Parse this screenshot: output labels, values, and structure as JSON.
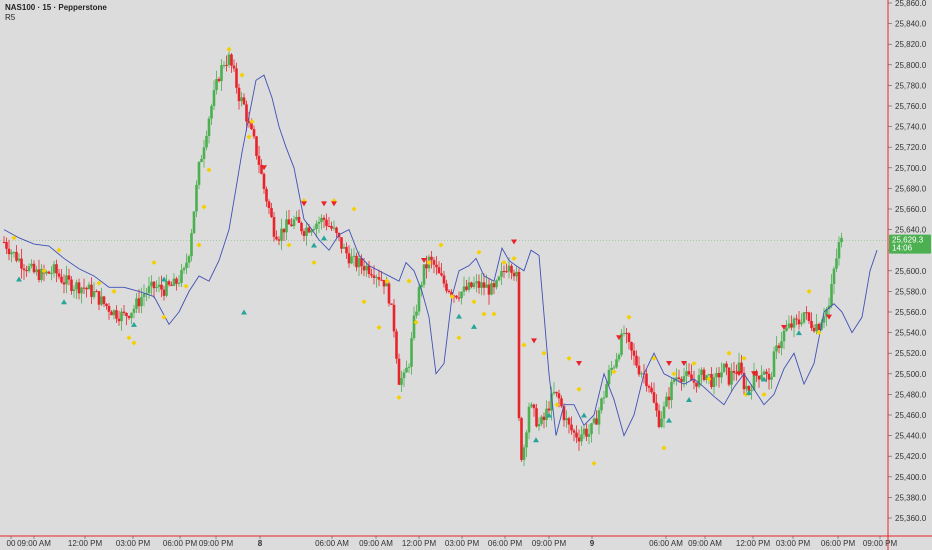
{
  "chart_data": {
    "type": "candlestick",
    "title": "NAS100 · 15 · Pepperstone",
    "indicator_label": "R5",
    "ylim": [
      25350,
      25870
    ],
    "y_ticks": [
      "25,360.0",
      "25,380.0",
      "25,400.0",
      "25,420.0",
      "25,440.0",
      "25,460.0",
      "25,480.0",
      "25,500.0",
      "25,520.0",
      "25,540.0",
      "25,560.0",
      "25,580.0",
      "25,600.0",
      "25,620.0",
      "25,640.0",
      "25,660.0",
      "25,680.0",
      "25,700.0",
      "25,720.0",
      "25,740.0",
      "25,760.0",
      "25,780.0",
      "25,800.0",
      "25,820.0",
      "25,840.0",
      "25,860.0"
    ],
    "x_ticks": [
      "00",
      "09:00 AM",
      "12:00 PM",
      "03:00 PM",
      "06:00 PM",
      "09:00 PM",
      "8",
      "06:00 AM",
      "09:00 AM",
      "12:00 PM",
      "03:00 PM",
      "06:00 PM",
      "09:00 PM",
      "9",
      "06:00 AM",
      "09:00 AM",
      "12:00 PM",
      "03:00 PM",
      "06:00 PM",
      "09:00 PM"
    ],
    "current_price": {
      "value": 25629.3,
      "label": "25,629.3",
      "countdown": "14:06"
    },
    "colors": {
      "up": "#4caf50",
      "down": "#e8232b",
      "line": "#3f51b5",
      "marker_yellow": "#f5d000",
      "marker_up": "#26a69a",
      "marker_down": "#e8232b",
      "price_tag": "#4caf50",
      "grid_ref": "#8bc98b",
      "axis_border": "#e8232b"
    },
    "close_anchors": [
      [
        0,
        25628
      ],
      [
        10,
        25616
      ],
      [
        20,
        25606
      ],
      [
        30,
        25598
      ],
      [
        40,
        25596
      ],
      [
        50,
        25600
      ],
      [
        60,
        25590
      ],
      [
        70,
        25586
      ],
      [
        80,
        25584
      ],
      [
        90,
        25578
      ],
      [
        100,
        25568
      ],
      [
        110,
        25560
      ],
      [
        120,
        25556
      ],
      [
        130,
        25564
      ],
      [
        140,
        25578
      ],
      [
        150,
        25584
      ],
      [
        160,
        25582
      ],
      [
        170,
        25586
      ],
      [
        180,
        25598
      ],
      [
        185,
        25620
      ],
      [
        190,
        25660
      ],
      [
        195,
        25700
      ],
      [
        200,
        25725
      ],
      [
        205,
        25750
      ],
      [
        210,
        25770
      ],
      [
        215,
        25790
      ],
      [
        220,
        25803
      ],
      [
        225,
        25806
      ],
      [
        230,
        25790
      ],
      [
        235,
        25770
      ],
      [
        240,
        25760
      ],
      [
        245,
        25740
      ],
      [
        250,
        25725
      ],
      [
        255,
        25705
      ],
      [
        260,
        25680
      ],
      [
        265,
        25660
      ],
      [
        270,
        25640
      ],
      [
        275,
        25635
      ],
      [
        280,
        25642
      ],
      [
        285,
        25644
      ],
      [
        290,
        25648
      ],
      [
        300,
        25640
      ],
      [
        310,
        25646
      ],
      [
        320,
        25650
      ],
      [
        330,
        25638
      ],
      [
        340,
        25620
      ],
      [
        350,
        25608
      ],
      [
        360,
        25605
      ],
      [
        370,
        25600
      ],
      [
        380,
        25590
      ],
      [
        385,
        25575
      ],
      [
        390,
        25545
      ],
      [
        395,
        25495
      ],
      [
        400,
        25495
      ],
      [
        405,
        25512
      ],
      [
        410,
        25550
      ],
      [
        415,
        25580
      ],
      [
        420,
        25600
      ],
      [
        425,
        25610
      ],
      [
        430,
        25605
      ],
      [
        435,
        25595
      ],
      [
        440,
        25588
      ],
      [
        450,
        25578
      ],
      [
        460,
        25580
      ],
      [
        470,
        25586
      ],
      [
        480,
        25585
      ],
      [
        490,
        25580
      ],
      [
        500,
        25600
      ],
      [
        505,
        25610
      ],
      [
        510,
        25600
      ],
      [
        513,
        25592
      ],
      [
        514,
        25470
      ],
      [
        517,
        25420
      ],
      [
        520,
        25430
      ],
      [
        525,
        25470
      ],
      [
        530,
        25460
      ],
      [
        535,
        25450
      ],
      [
        540,
        25455
      ],
      [
        545,
        25470
      ],
      [
        550,
        25480
      ],
      [
        555,
        25475
      ],
      [
        560,
        25460
      ],
      [
        565,
        25448
      ],
      [
        570,
        25442
      ],
      [
        575,
        25440
      ],
      [
        580,
        25445
      ],
      [
        585,
        25442
      ],
      [
        590,
        25450
      ],
      [
        595,
        25465
      ],
      [
        600,
        25480
      ],
      [
        605,
        25500
      ],
      [
        610,
        25510
      ],
      [
        615,
        25525
      ],
      [
        620,
        25540
      ],
      [
        625,
        25525
      ],
      [
        630,
        25515
      ],
      [
        635,
        25505
      ],
      [
        640,
        25500
      ],
      [
        645,
        25490
      ],
      [
        650,
        25470
      ],
      [
        655,
        25455
      ],
      [
        660,
        25465
      ],
      [
        665,
        25480
      ],
      [
        670,
        25495
      ],
      [
        675,
        25500
      ],
      [
        680,
        25498
      ],
      [
        685,
        25495
      ],
      [
        690,
        25492
      ],
      [
        695,
        25495
      ],
      [
        700,
        25500
      ],
      [
        705,
        25497
      ],
      [
        710,
        25490
      ],
      [
        715,
        25500
      ],
      [
        720,
        25505
      ],
      [
        725,
        25495
      ],
      [
        730,
        25503
      ],
      [
        735,
        25505
      ],
      [
        740,
        25490
      ],
      [
        745,
        25485
      ],
      [
        750,
        25497
      ],
      [
        755,
        25500
      ],
      [
        760,
        25505
      ],
      [
        765,
        25490
      ],
      [
        770,
        25515
      ],
      [
        775,
        25530
      ],
      [
        780,
        25540
      ],
      [
        785,
        25545
      ],
      [
        790,
        25548
      ],
      [
        795,
        25550
      ],
      [
        800,
        25560
      ],
      [
        805,
        25550
      ],
      [
        810,
        25548
      ],
      [
        815,
        25548
      ],
      [
        820,
        25560
      ],
      [
        825,
        25565
      ],
      [
        830,
        25600
      ],
      [
        835,
        25625
      ],
      [
        838,
        25629
      ]
    ],
    "line_anchors": [
      [
        0,
        25640
      ],
      [
        15,
        25632
      ],
      [
        30,
        25626
      ],
      [
        45,
        25624
      ],
      [
        60,
        25612
      ],
      [
        75,
        25602
      ],
      [
        90,
        25595
      ],
      [
        105,
        25584
      ],
      [
        120,
        25584
      ],
      [
        135,
        25580
      ],
      [
        150,
        25575
      ],
      [
        165,
        25548
      ],
      [
        175,
        25560
      ],
      [
        185,
        25580
      ],
      [
        195,
        25595
      ],
      [
        205,
        25590
      ],
      [
        215,
        25610
      ],
      [
        225,
        25640
      ],
      [
        232,
        25680
      ],
      [
        238,
        25715
      ],
      [
        245,
        25750
      ],
      [
        252,
        25785
      ],
      [
        260,
        25790
      ],
      [
        268,
        25768
      ],
      [
        275,
        25740
      ],
      [
        282,
        25720
      ],
      [
        290,
        25700
      ],
      [
        300,
        25650
      ],
      [
        308,
        25640
      ],
      [
        315,
        25630
      ],
      [
        325,
        25620
      ],
      [
        335,
        25635
      ],
      [
        345,
        25640
      ],
      [
        355,
        25615
      ],
      [
        365,
        25605
      ],
      [
        375,
        25600
      ],
      [
        385,
        25595
      ],
      [
        395,
        25590
      ],
      [
        402,
        25608
      ],
      [
        410,
        25600
      ],
      [
        418,
        25580
      ],
      [
        425,
        25555
      ],
      [
        432,
        25500
      ],
      [
        440,
        25510
      ],
      [
        448,
        25575
      ],
      [
        455,
        25600
      ],
      [
        465,
        25605
      ],
      [
        472,
        25612
      ],
      [
        480,
        25595
      ],
      [
        490,
        25590
      ],
      [
        498,
        25622
      ],
      [
        505,
        25610
      ],
      [
        512,
        25605
      ],
      [
        520,
        25600
      ],
      [
        527,
        25620
      ],
      [
        535,
        25615
      ],
      [
        545,
        25500
      ],
      [
        552,
        25440
      ],
      [
        560,
        25470
      ],
      [
        570,
        25470
      ],
      [
        580,
        25450
      ],
      [
        590,
        25460
      ],
      [
        600,
        25500
      ],
      [
        610,
        25475
      ],
      [
        620,
        25440
      ],
      [
        630,
        25460
      ],
      [
        640,
        25500
      ],
      [
        650,
        25520
      ],
      [
        660,
        25500
      ],
      [
        670,
        25495
      ],
      [
        680,
        25490
      ],
      [
        690,
        25495
      ],
      [
        700,
        25487
      ],
      [
        710,
        25478
      ],
      [
        720,
        25470
      ],
      [
        730,
        25487
      ],
      [
        740,
        25500
      ],
      [
        750,
        25485
      ],
      [
        760,
        25470
      ],
      [
        770,
        25480
      ],
      [
        780,
        25505
      ],
      [
        790,
        25520
      ],
      [
        800,
        25490
      ],
      [
        810,
        25510
      ],
      [
        820,
        25560
      ],
      [
        830,
        25568
      ],
      [
        838,
        25560
      ],
      [
        848,
        25540
      ],
      [
        858,
        25555
      ],
      [
        866,
        25600
      ],
      [
        873,
        25620
      ]
    ]
  },
  "markers": {
    "yellow": [
      [
        10,
        25632
      ],
      [
        40,
        25600
      ],
      [
        55,
        25620
      ],
      [
        95,
        25588
      ],
      [
        110,
        25580
      ],
      [
        125,
        25535
      ],
      [
        130,
        25530
      ],
      [
        150,
        25608
      ],
      [
        160,
        25555
      ],
      [
        182,
        25585
      ],
      [
        195,
        25625
      ],
      [
        200,
        25662
      ],
      [
        205,
        25698
      ],
      [
        225,
        25815
      ],
      [
        238,
        25790
      ],
      [
        245,
        25730
      ],
      [
        248,
        25745
      ],
      [
        285,
        25625
      ],
      [
        300,
        25668
      ],
      [
        310,
        25608
      ],
      [
        330,
        25668
      ],
      [
        350,
        25660
      ],
      [
        360,
        25570
      ],
      [
        375,
        25545
      ],
      [
        383,
        25590
      ],
      [
        395,
        25477
      ],
      [
        405,
        25590
      ],
      [
        412,
        25550
      ],
      [
        425,
        25608
      ],
      [
        437,
        25625
      ],
      [
        448,
        25575
      ],
      [
        455,
        25535
      ],
      [
        470,
        25570
      ],
      [
        475,
        25618
      ],
      [
        480,
        25558
      ],
      [
        490,
        25558
      ],
      [
        500,
        25608
      ],
      [
        510,
        25612
      ],
      [
        520,
        25528
      ],
      [
        540,
        25520
      ],
      [
        553,
        25470
      ],
      [
        565,
        25515
      ],
      [
        575,
        25485
      ],
      [
        590,
        25413
      ],
      [
        610,
        25502
      ],
      [
        625,
        25555
      ],
      [
        650,
        25515
      ],
      [
        660,
        25428
      ],
      [
        670,
        25500
      ],
      [
        690,
        25510
      ],
      [
        705,
        25495
      ],
      [
        725,
        25520
      ],
      [
        740,
        25515
      ],
      [
        742,
        25480
      ],
      [
        760,
        25480
      ],
      [
        805,
        25580
      ],
      [
        815,
        25540
      ]
    ],
    "triangles_up": [
      [
        15,
        25592
      ],
      [
        60,
        25570
      ],
      [
        130,
        25548
      ],
      [
        160,
        25592
      ],
      [
        240,
        25560
      ],
      [
        310,
        25625
      ],
      [
        320,
        25632
      ],
      [
        455,
        25556
      ],
      [
        470,
        25546
      ],
      [
        532,
        25436
      ],
      [
        545,
        25460
      ],
      [
        580,
        25460
      ],
      [
        665,
        25455
      ],
      [
        685,
        25475
      ],
      [
        745,
        25482
      ],
      [
        760,
        25495
      ],
      [
        795,
        25540
      ]
    ],
    "triangles_down": [
      [
        260,
        25700
      ],
      [
        300,
        25665
      ],
      [
        320,
        25665
      ],
      [
        330,
        25665
      ],
      [
        420,
        25610
      ],
      [
        510,
        25628
      ],
      [
        530,
        25532
      ],
      [
        575,
        25510
      ],
      [
        615,
        25535
      ],
      [
        665,
        25510
      ],
      [
        680,
        25510
      ],
      [
        735,
        25500
      ],
      [
        750,
        25500
      ],
      [
        780,
        25545
      ],
      [
        825,
        25555
      ]
    ]
  }
}
